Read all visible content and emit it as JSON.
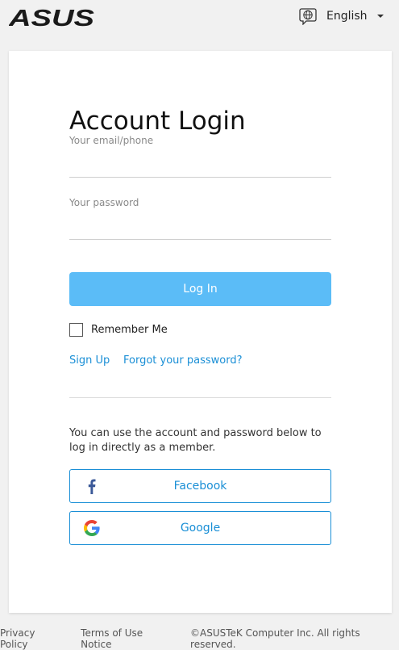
{
  "header": {
    "logo_text": "ASUS",
    "language": "English"
  },
  "login": {
    "title": "Account Login",
    "email_label": "Your email/phone",
    "email_value": "",
    "password_label": "Your password",
    "password_value": "",
    "login_button": "Log In",
    "remember_me": "Remember Me",
    "remember_checked": false,
    "sign_up": "Sign Up",
    "forgot_password": "Forgot your password?",
    "info_text": "You can use the account and password below to log in directly as a member.",
    "facebook": "Facebook",
    "google": "Google"
  },
  "footer": {
    "privacy": "Privacy Policy",
    "terms": "Terms of Use Notice",
    "copyright": "©ASUSTeK Computer Inc. All rights reserved."
  },
  "colors": {
    "accent": "#1a8fd6",
    "login_button": "#5bbcf7",
    "background": "#f1f1f1",
    "facebook_blue": "#3b5998"
  },
  "icons": [
    "asus-logo",
    "globe-icon",
    "caret-down-icon",
    "facebook-icon",
    "google-icon"
  ]
}
